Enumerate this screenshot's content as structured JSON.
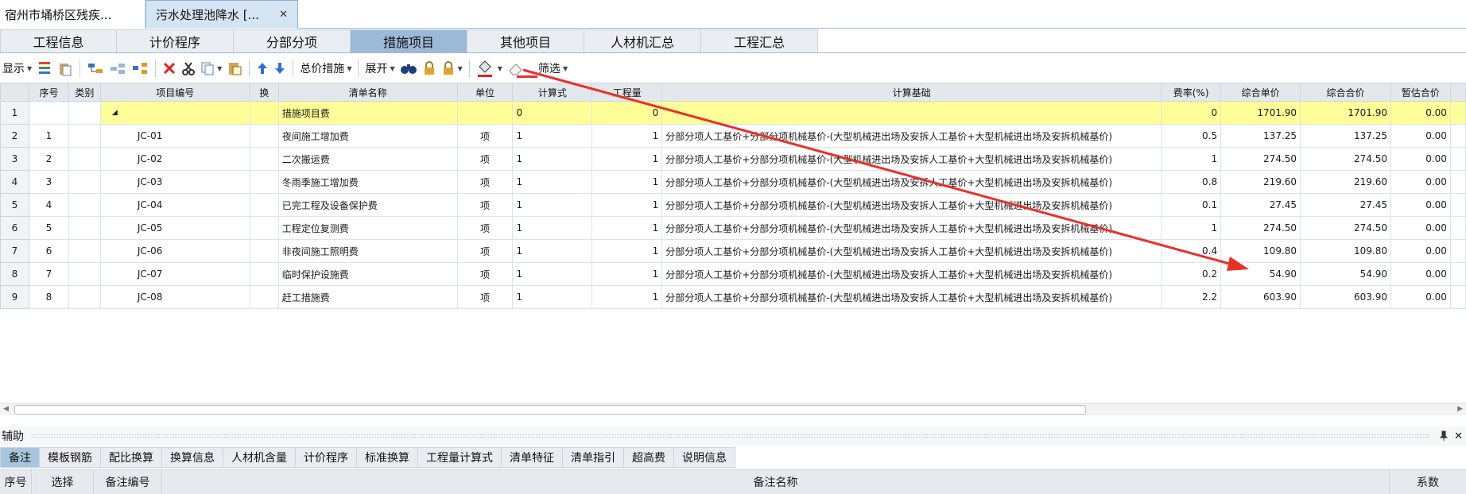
{
  "doc_tabs": [
    {
      "label": "宿州市埇桥区残疾..."
    },
    {
      "label": "污水处理池降水 [...",
      "close": "✕"
    }
  ],
  "module_tabs": [
    "工程信息",
    "计价程序",
    "分部分项",
    "措施项目",
    "其他项目",
    "人材机汇总",
    "工程汇总"
  ],
  "active_module_tab": "措施项目",
  "toolbar": {
    "display_label": "显示",
    "total_price_measure_label": "总价措施",
    "expand_label": "展开",
    "filter_label": "筛选"
  },
  "colors": {
    "highlight_row": "#ffff99",
    "active_tab": "#9cbad8",
    "annotation_arrow": "#e8302a"
  },
  "grid": {
    "columns": [
      "序号",
      "类别",
      "项目编号",
      "换",
      "清单名称",
      "单位",
      "计算式",
      "工程量",
      "计算基础",
      "费率(%)",
      "综合单价",
      "综合合价",
      "暂估合价"
    ],
    "rows": [
      {
        "row_no": "1",
        "seq": "",
        "category": "",
        "code": "◢",
        "swap": "",
        "name": "措施项目费",
        "unit": "",
        "formula": "0",
        "quantity": "0",
        "basis": "",
        "rate": "0",
        "unit_price": "1701.90",
        "total_price": "1701.90",
        "provisional": "0.00"
      },
      {
        "row_no": "2",
        "seq": "1",
        "category": "",
        "code": "JC-01",
        "swap": "",
        "name": "夜间施工增加费",
        "unit": "项",
        "formula": "1",
        "quantity": "1",
        "basis": "分部分项人工基价+分部分项机械基价-(大型机械进出场及安拆人工基价+大型机械进出场及安拆机械基价)",
        "rate": "0.5",
        "unit_price": "137.25",
        "total_price": "137.25",
        "provisional": "0.00"
      },
      {
        "row_no": "3",
        "seq": "2",
        "category": "",
        "code": "JC-02",
        "swap": "",
        "name": "二次搬运费",
        "unit": "项",
        "formula": "1",
        "quantity": "1",
        "basis": "分部分项人工基价+分部分项机械基价-(大型机械进出场及安拆人工基价+大型机械进出场及安拆机械基价)",
        "rate": "1",
        "unit_price": "274.50",
        "total_price": "274.50",
        "provisional": "0.00"
      },
      {
        "row_no": "4",
        "seq": "3",
        "category": "",
        "code": "JC-03",
        "swap": "",
        "name": "冬雨季施工增加费",
        "unit": "项",
        "formula": "1",
        "quantity": "1",
        "basis": "分部分项人工基价+分部分项机械基价-(大型机械进出场及安拆人工基价+大型机械进出场及安拆机械基价)",
        "rate": "0.8",
        "unit_price": "219.60",
        "total_price": "219.60",
        "provisional": "0.00"
      },
      {
        "row_no": "5",
        "seq": "4",
        "category": "",
        "code": "JC-04",
        "swap": "",
        "name": "已完工程及设备保护费",
        "unit": "项",
        "formula": "1",
        "quantity": "1",
        "basis": "分部分项人工基价+分部分项机械基价-(大型机械进出场及安拆人工基价+大型机械进出场及安拆机械基价)",
        "rate": "0.1",
        "unit_price": "27.45",
        "total_price": "27.45",
        "provisional": "0.00"
      },
      {
        "row_no": "6",
        "seq": "5",
        "category": "",
        "code": "JC-05",
        "swap": "",
        "name": "工程定位复测费",
        "unit": "项",
        "formula": "1",
        "quantity": "1",
        "basis": "分部分项人工基价+分部分项机械基价-(大型机械进出场及安拆人工基价+大型机械进出场及安拆机械基价)",
        "rate": "1",
        "unit_price": "274.50",
        "total_price": "274.50",
        "provisional": "0.00"
      },
      {
        "row_no": "7",
        "seq": "6",
        "category": "",
        "code": "JC-06",
        "swap": "",
        "name": "非夜间施工照明费",
        "unit": "项",
        "formula": "1",
        "quantity": "1",
        "basis": "分部分项人工基价+分部分项机械基价-(大型机械进出场及安拆人工基价+大型机械进出场及安拆机械基价)",
        "rate": "0.4",
        "unit_price": "109.80",
        "total_price": "109.80",
        "provisional": "0.00"
      },
      {
        "row_no": "8",
        "seq": "7",
        "category": "",
        "code": "JC-07",
        "swap": "",
        "name": "临时保护设施费",
        "unit": "项",
        "formula": "1",
        "quantity": "1",
        "basis": "分部分项人工基价+分部分项机械基价-(大型机械进出场及安拆人工基价+大型机械进出场及安拆机械基价)",
        "rate": "0.2",
        "unit_price": "54.90",
        "total_price": "54.90",
        "provisional": "0.00"
      },
      {
        "row_no": "9",
        "seq": "8",
        "category": "",
        "code": "JC-08",
        "swap": "",
        "name": "赶工措施费",
        "unit": "项",
        "formula": "1",
        "quantity": "1",
        "basis": "分部分项人工基价+分部分项机械基价-(大型机械进出场及安拆人工基价+大型机械进出场及安拆机械基价)",
        "rate": "2.2",
        "unit_price": "603.90",
        "total_price": "603.90",
        "provisional": "0.00"
      }
    ]
  },
  "aux_panel": {
    "title": "辅助",
    "tabs": [
      "备注",
      "模板钢筋",
      "配比换算",
      "换算信息",
      "人材机含量",
      "计价程序",
      "标准换算",
      "工程量计算式",
      "清单特征",
      "清单指引",
      "超高费",
      "说明信息"
    ],
    "active_tab": "备注",
    "columns": [
      "序号",
      "选择",
      "备注编号",
      "备注名称",
      "系数"
    ]
  }
}
